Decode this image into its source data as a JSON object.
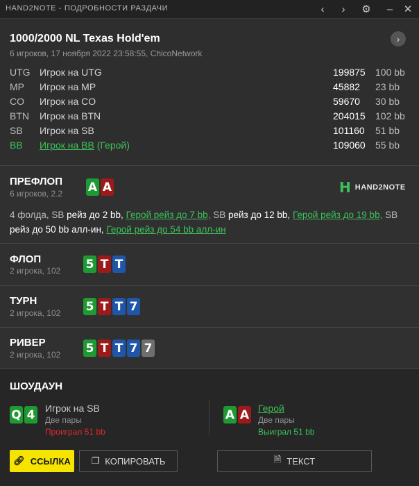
{
  "window": {
    "title": "HAND2NOTE - ПОДРОБНОСТИ РАЗДАЧИ",
    "icons": {
      "back": "chevron-left-icon",
      "forward": "chevron-right-icon",
      "settings": "gear-icon",
      "minimize": "minimize-icon",
      "close": "close-icon"
    }
  },
  "header": {
    "title": "1000/2000 NL Texas Hold'em",
    "subtitle": "6 игроков, 17 ноября 2022 23:58:55, ChicoNetwork"
  },
  "players": [
    {
      "pos": "UTG",
      "name": "Игрок на UTG",
      "stack": "199875",
      "bb": "100 bb",
      "hero": false
    },
    {
      "pos": "MP",
      "name": "Игрок на MP",
      "stack": "45882",
      "bb": "23 bb",
      "hero": false
    },
    {
      "pos": "CO",
      "name": "Игрок на CO",
      "stack": "59670",
      "bb": "30 bb",
      "hero": false
    },
    {
      "pos": "BTN",
      "name": "Игрок на BTN",
      "stack": "204015",
      "bb": "102 bb",
      "hero": false
    },
    {
      "pos": "SB",
      "name": "Игрок на SB",
      "stack": "101160",
      "bb": "51 bb",
      "hero": false
    },
    {
      "pos": "BB",
      "name": "Игрок на BB",
      "hero_tag": "(Герой)",
      "stack": "109060",
      "bb": "55 bb",
      "hero": true
    }
  ],
  "preflop": {
    "title": "ПРЕФЛОП",
    "sub": "6 игроков, 2.2",
    "cards": [
      "A",
      "A"
    ],
    "logo": {
      "mark": "H",
      "text": "HAND2NOTE"
    },
    "actions": {
      "a1": "4 фолда, SB",
      "a2": "рейз до 2 bb,",
      "a3": "Герой рейз до 7 bb,",
      "a4": "SB",
      "a5": "рейз до 12 bb,",
      "a6": "Герой рейз до 19 bb,",
      "a7": "SB",
      "a8": "рейз до 50 bb алл-ин,",
      "a9": "Герой рейз до 54 bb алл-ин"
    }
  },
  "streets": [
    {
      "title": "ФЛОП",
      "sub": "2 игрока, 102",
      "cards": [
        "5",
        "T",
        "T"
      ]
    },
    {
      "title": "ТУРН",
      "sub": "2 игрока, 102",
      "cards": [
        "5",
        "T",
        "T",
        "7"
      ]
    },
    {
      "title": "РИВЕР",
      "sub": "2 игрока, 102",
      "cards": [
        "5",
        "T",
        "T",
        "7",
        "7"
      ]
    }
  ],
  "showdown": {
    "title": "ШОУДАУН",
    "left": {
      "cards": [
        "Q",
        "4"
      ],
      "name": "Игрок на SB",
      "hand": "Две пары",
      "result": "Проиграл 51 bb"
    },
    "right": {
      "cards": [
        "A",
        "A"
      ],
      "name": "Герой",
      "hand": "Две пары",
      "result": "Выиграл 51 bb"
    }
  },
  "buttons": {
    "link": "ССЫЛКА",
    "copy": "КОПИРОВАТЬ",
    "text": "ТЕКСТ"
  },
  "colors": {
    "hero_green": "#3cc25a",
    "card_green": "#1f9a33",
    "card_red": "#9b1b1b",
    "card_blue": "#1f56a7",
    "card_gray": "#6e6e6e",
    "link_button": "#f5e400",
    "lost_red": "#e02a2a"
  }
}
